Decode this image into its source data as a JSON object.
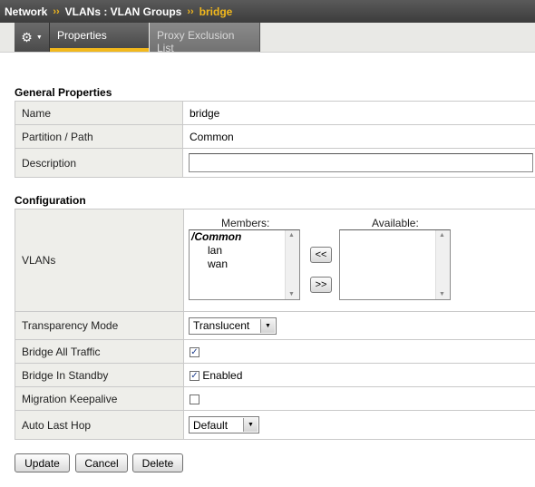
{
  "breadcrumb": {
    "items": [
      "Network",
      "VLANs : VLAN Groups"
    ],
    "current": "bridge",
    "separator": "››"
  },
  "tabs": {
    "gear_icon": "gear-icon",
    "active": "Properties",
    "inactive": "Proxy Exclusion List"
  },
  "general": {
    "title": "General Properties",
    "rows": [
      {
        "label": "Name",
        "value": "bridge"
      },
      {
        "label": "Partition / Path",
        "value": "Common"
      },
      {
        "label": "Description",
        "value": ""
      }
    ]
  },
  "configuration": {
    "title": "Configuration",
    "vlans": {
      "label": "VLANs",
      "members_header": "Members:",
      "available_header": "Available:",
      "members_group": "/Common",
      "members": [
        "lan",
        "wan"
      ],
      "available": [],
      "move_left_label": "<<",
      "move_right_label": ">>"
    },
    "transparency": {
      "label": "Transparency Mode",
      "value": "Translucent"
    },
    "bridge_all": {
      "label": "Bridge All Traffic",
      "checked": true
    },
    "bridge_standby": {
      "label": "Bridge In Standby",
      "checked": true,
      "text": "Enabled"
    },
    "migration": {
      "label": "Migration Keepalive",
      "checked": false
    },
    "auto_last_hop": {
      "label": "Auto Last Hop",
      "value": "Default"
    }
  },
  "buttons": {
    "update": "Update",
    "cancel": "Cancel",
    "delete": "Delete"
  },
  "colors": {
    "accent": "#f2b81c",
    "header_dark": "#4a4a4a"
  }
}
